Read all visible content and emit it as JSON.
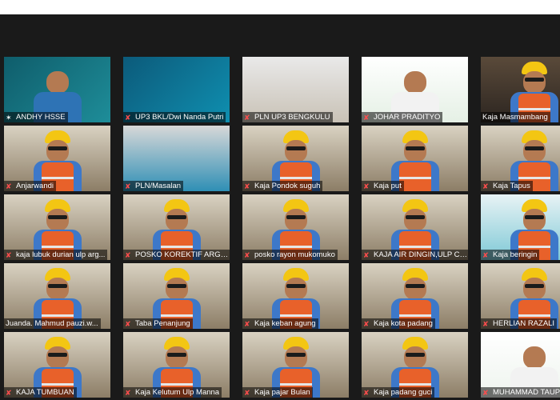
{
  "colors": {
    "background": "#1a1a1a",
    "active_border": "#e9f28a",
    "mic_muted": "#ff4d4d",
    "helmet": "#f3c613",
    "vest": "#e8612a"
  },
  "participants": [
    {
      "name": "ANDHY HSSE",
      "icon": "pin-icon",
      "feed": "slide-teal"
    },
    {
      "name": "UP3 BKL/Dwi Nanda Putri",
      "icon": "mic-off-icon",
      "feed": "slide-blue"
    },
    {
      "name": "PLN UP3 BENGKULU",
      "icon": "mic-off-icon",
      "feed": "room"
    },
    {
      "name": "JOHAR PRADITYO",
      "icon": "mic-off-icon",
      "feed": "briefing"
    },
    {
      "name": "Kaja Masmambang",
      "icon": "",
      "feed": "person-dark",
      "active": true
    },
    {
      "name": "Anjarwandi",
      "icon": "mic-off-icon",
      "feed": "person"
    },
    {
      "name": "PLN/Masalan",
      "icon": "mic-off-icon",
      "feed": "screen"
    },
    {
      "name": "Kaja Pondok suguh",
      "icon": "mic-off-icon",
      "feed": "person"
    },
    {
      "name": "Kaja put",
      "icon": "mic-off-icon",
      "feed": "person"
    },
    {
      "name": "Kaja Tapus",
      "icon": "mic-off-icon",
      "feed": "person"
    },
    {
      "name": "kaja lubuk durian ulp arg...",
      "icon": "mic-off-icon",
      "feed": "person"
    },
    {
      "name": "POSKO KOREKTIF ARGAM...",
      "icon": "mic-off-icon",
      "feed": "person"
    },
    {
      "name": "posko rayon mukomuko",
      "icon": "mic-off-icon",
      "feed": "person"
    },
    {
      "name": "KAJA AIR DINGIN,ULP CU...",
      "icon": "mic-off-icon",
      "feed": "person"
    },
    {
      "name": "Kaja beringin",
      "icon": "mic-off-icon",
      "feed": "person-sign"
    },
    {
      "name": "Juanda. Mahmud pauzi.w...",
      "icon": "",
      "feed": "person"
    },
    {
      "name": "Taba Penanjung",
      "icon": "mic-off-icon",
      "feed": "person"
    },
    {
      "name": "Kaja keban agung",
      "icon": "mic-off-icon",
      "feed": "person"
    },
    {
      "name": "Kaja kota padang",
      "icon": "mic-off-icon",
      "feed": "person"
    },
    {
      "name": "HERLIAN RAZALI",
      "icon": "mic-off-icon",
      "feed": "person"
    },
    {
      "name": "KAJA TUMBUAN",
      "icon": "mic-off-icon",
      "feed": "person"
    },
    {
      "name": "Kaja Kelutum Ulp Manna",
      "icon": "mic-off-icon",
      "feed": "person"
    },
    {
      "name": "Kaja pajar Bulan",
      "icon": "mic-off-icon",
      "feed": "person"
    },
    {
      "name": "Kaja padang guci",
      "icon": "mic-off-icon",
      "feed": "person"
    },
    {
      "name": "MUHAMMAD TAUPIK",
      "icon": "mic-off-icon",
      "feed": "briefing2"
    }
  ]
}
